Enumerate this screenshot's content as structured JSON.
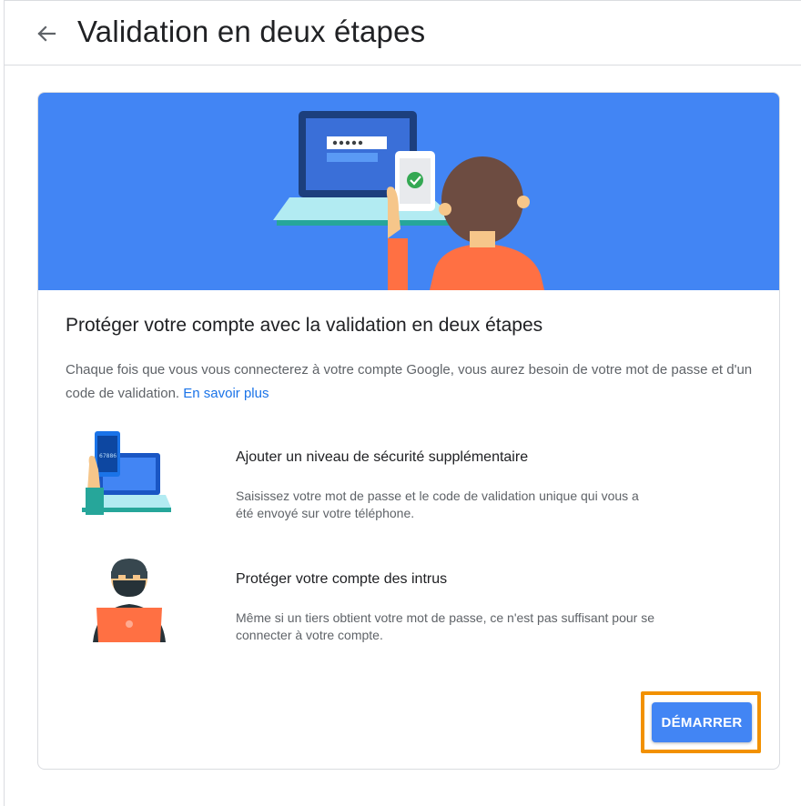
{
  "header": {
    "back_icon": "arrow-back-icon",
    "title": "Validation en deux étapes"
  },
  "card": {
    "banner_color": "#4285f4",
    "title": "Protéger votre compte avec la validation en deux étapes",
    "description": "Chaque fois que vous vous connecterez à votre compte Google, vous aurez besoin de votre mot de passe et d'un code de validation.",
    "learn_more": "En savoir plus",
    "features": [
      {
        "icon": "phone-laptop-illustration",
        "title": "Ajouter un niveau de sécurité supplémentaire",
        "description": "Saisissez votre mot de passe et le code de validation unique qui vous a été envoyé sur votre téléphone."
      },
      {
        "icon": "intruder-illustration",
        "title": "Protéger votre compte des intrus",
        "description": "Même si un tiers obtient votre mot de passe, ce n'est pas suffisant pour se connecter à votre compte."
      }
    ],
    "start_button": "DÉMARRER",
    "highlight_color": "#f29100"
  }
}
